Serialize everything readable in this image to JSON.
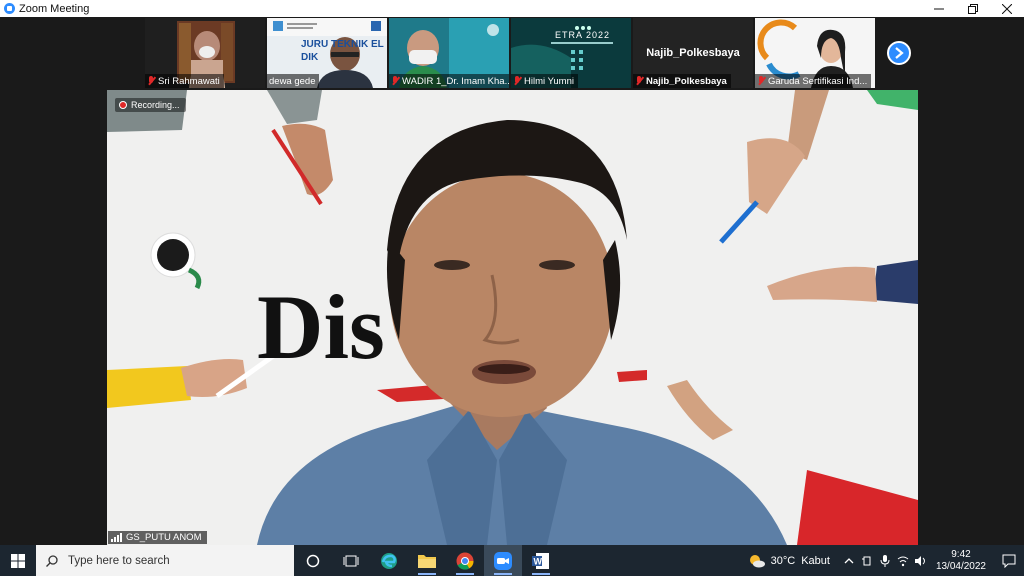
{
  "window": {
    "title": "Zoom Meeting",
    "controls": [
      "minimize",
      "maximize",
      "close"
    ]
  },
  "participants": [
    {
      "name": "Sri Rahmawati",
      "muted": true
    },
    {
      "name": "dewa gede",
      "muted": false
    },
    {
      "name": "WADIR 1_Dr. Imam Kha...",
      "muted": true
    },
    {
      "name": "Hilmi Yumni",
      "muted": true
    },
    {
      "name": "Najib_Polkesbaya",
      "muted": true,
      "display_name": "Najib_Polkesbaya"
    },
    {
      "name": "Garuda Sertifikasi Ind...",
      "muted": true
    }
  ],
  "tile_texts": {
    "dewa_banner": "JURU TEKNIK EL DIK",
    "hilmi_banner": "ETRA 2022"
  },
  "main": {
    "recording_label": "Recording...",
    "speaker_name": "GS_PUTU ANOM",
    "background_word": "Dis     on"
  },
  "taskbar": {
    "search_placeholder": "Type here to search",
    "weather_temp": "30°C",
    "weather_desc": "Kabut",
    "time": "9:42",
    "date": "13/04/2022"
  },
  "colors": {
    "zoom_blue": "#2d8cff",
    "mute_red": "#e02828",
    "taskbar_bg": "#1c2630"
  }
}
